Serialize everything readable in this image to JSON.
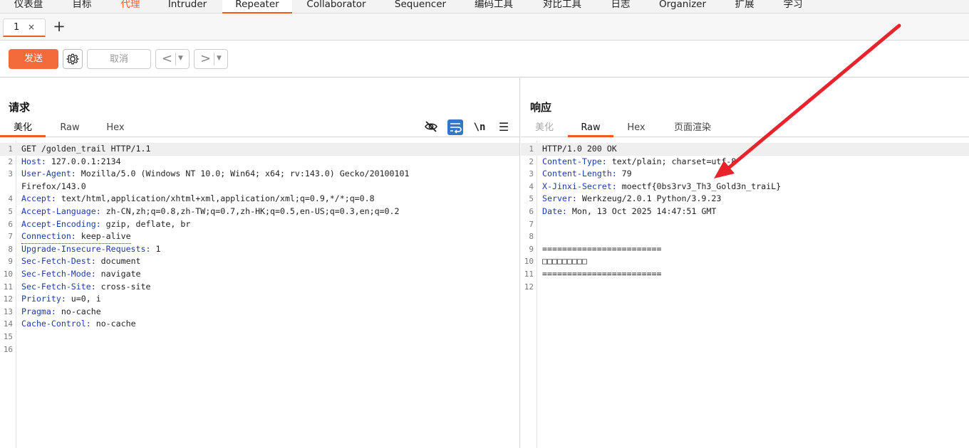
{
  "topnav": {
    "tabs": [
      "仪表盘",
      "目标",
      "代理",
      "Intruder",
      "Repeater",
      "Collaborator",
      "Sequencer",
      "编码工具",
      "对比工具",
      "日志",
      "Organizer",
      "扩展",
      "学习"
    ]
  },
  "subtabs": {
    "tab1_label": "1",
    "close": "×",
    "add": "+"
  },
  "toolbar": {
    "send_label": "发送",
    "cancel_label": "取消",
    "back": "<",
    "forward": ">"
  },
  "request": {
    "title": "请求",
    "tabs": [
      "美化",
      "Raw",
      "Hex"
    ],
    "icons": {
      "hide": "eye-slash-icon",
      "wrap": "wrap-icon",
      "newline_label": "\\n",
      "menu": "hamburger-icon"
    },
    "lines": [
      {
        "n": "1",
        "name": "",
        "value": "GET /golden_trail HTTP/1.1"
      },
      {
        "n": "2",
        "name": "Host:",
        "value": " 127.0.0.1:2134"
      },
      {
        "n": "3",
        "name": "User-Agent:",
        "value": " Mozilla/5.0 (Windows NT 10.0; Win64; x64; rv:143.0) Gecko/20100101"
      },
      {
        "n": "",
        "name": "",
        "value": "Firefox/143.0"
      },
      {
        "n": "4",
        "name": "Accept:",
        "value": " text/html,application/xhtml+xml,application/xml;q=0.9,*/*;q=0.8"
      },
      {
        "n": "5",
        "name": "Accept-Language:",
        "value": " zh-CN,zh;q=0.8,zh-TW;q=0.7,zh-HK;q=0.5,en-US;q=0.3,en;q=0.2"
      },
      {
        "n": "6",
        "name": "Accept-Encoding:",
        "value": " gzip, deflate, br"
      },
      {
        "n": "7",
        "name": "Connection:",
        "value": " keep-alive"
      },
      {
        "n": "8",
        "name": "Upgrade-Insecure-Requests:",
        "value": " 1"
      },
      {
        "n": "9",
        "name": "Sec-Fetch-Dest:",
        "value": " document"
      },
      {
        "n": "10",
        "name": "Sec-Fetch-Mode:",
        "value": " navigate"
      },
      {
        "n": "11",
        "name": "Sec-Fetch-Site:",
        "value": " cross-site"
      },
      {
        "n": "12",
        "name": "Priority:",
        "value": " u=0, i"
      },
      {
        "n": "13",
        "name": "Pragma:",
        "value": " no-cache"
      },
      {
        "n": "14",
        "name": "Cache-Control:",
        "value": " no-cache"
      },
      {
        "n": "15",
        "name": "",
        "value": ""
      },
      {
        "n": "16",
        "name": "",
        "value": ""
      }
    ]
  },
  "response": {
    "title": "响应",
    "tabs": [
      "美化",
      "Raw",
      "Hex",
      "页面渲染"
    ],
    "lines": [
      {
        "n": "1",
        "name": "",
        "value": "HTTP/1.0 200 OK"
      },
      {
        "n": "2",
        "name": "Content-Type:",
        "value": " text/plain; charset=utf-8"
      },
      {
        "n": "3",
        "name": "Content-Length:",
        "value": " 79"
      },
      {
        "n": "4",
        "name": "X-Jinxi-Secret:",
        "value": " moectf{0bs3rv3_Th3_Gold3n_traiL}"
      },
      {
        "n": "5",
        "name": "Server:",
        "value": " Werkzeug/2.0.1 Python/3.9.23"
      },
      {
        "n": "6",
        "name": "Date:",
        "value": " Mon, 13 Oct 2025 14:47:51 GMT"
      },
      {
        "n": "7",
        "name": "",
        "value": ""
      },
      {
        "n": "8",
        "name": "",
        "value": ""
      },
      {
        "n": "9",
        "name": "",
        "value": "========================"
      },
      {
        "n": "10",
        "name": "",
        "value": "□□□□□□□□□"
      },
      {
        "n": "11",
        "name": "",
        "value": "========================"
      },
      {
        "n": "12",
        "name": "",
        "value": ""
      }
    ]
  },
  "annotation": {
    "color": "#e8232b"
  }
}
